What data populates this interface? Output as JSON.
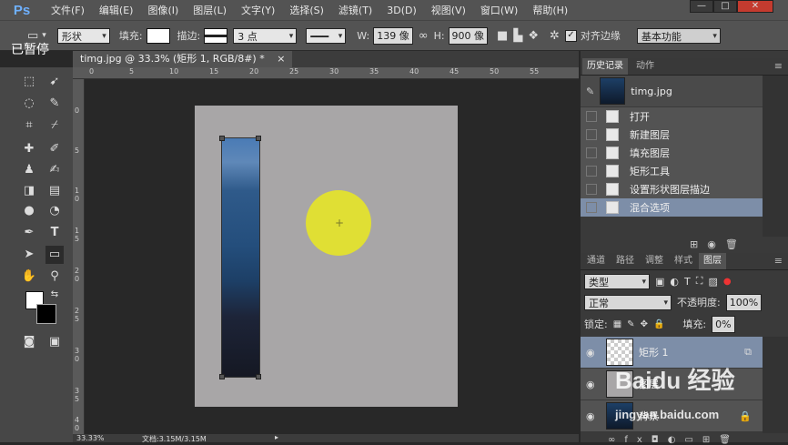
{
  "app": {
    "logo": "Ps",
    "paused_overlay": "已暂停"
  },
  "menu": [
    "文件(F)",
    "编辑(E)",
    "图像(I)",
    "图层(L)",
    "文字(Y)",
    "选择(S)",
    "滤镜(T)",
    "3D(D)",
    "视图(V)",
    "窗口(W)",
    "帮助(H)"
  ],
  "window_controls": {
    "minimize": "—",
    "restore": "□",
    "close": "✕"
  },
  "options": {
    "mode": "形状",
    "fill_label": "填充:",
    "stroke_label": "描边:",
    "stroke_width": "3 点",
    "w_label": "W:",
    "w_value": "139 像",
    "h_label": "H:",
    "h_value": "900 像",
    "align_edges": "对齐边缘",
    "workspace": "基本功能"
  },
  "document_tab": {
    "title": "timg.jpg @ 33.3% (矩形 1, RGB/8#) *",
    "close": "×"
  },
  "status": {
    "zoom": "33.33%",
    "doc_size": "文档:3.15M/3.15M"
  },
  "history_panel": {
    "tabs": [
      "历史记录",
      "动作"
    ],
    "snapshot": "timg.jpg",
    "items": [
      "打开",
      "新建图层",
      "填充图层",
      "矩形工具",
      "设置形状图层描边",
      "混合选项"
    ],
    "selected_index": 5
  },
  "layers_panel": {
    "tabs": [
      "通道",
      "路径",
      "调整",
      "样式",
      "图层"
    ],
    "filter": "类型",
    "blend_mode": "正常",
    "opacity_label": "不透明度:",
    "opacity": "100%",
    "lock_label": "锁定:",
    "fill_label": "填充:",
    "fill": "0%",
    "layers": [
      {
        "name": "矩形 1",
        "selected": true
      },
      {
        "name": "图层",
        "selected": false
      },
      {
        "name": "背景",
        "selected": false
      }
    ]
  },
  "watermark": {
    "brand": "Baidu 经验",
    "url": "jingyan.baidu.com"
  },
  "ruler": {
    "h_ticks": [
      "0",
      "5",
      "10",
      "15",
      "20",
      "25",
      "30",
      "35",
      "40",
      "45",
      "50",
      "55"
    ],
    "v_ticks": [
      "0",
      "5",
      "1 0",
      "1 5",
      "2 0",
      "2 5",
      "3 0",
      "3 5",
      "4 0"
    ]
  },
  "colors": {
    "shape_fill": "#e0df34",
    "history_selected": "#7d8ea8",
    "document_bg": "#a8a6a7"
  }
}
